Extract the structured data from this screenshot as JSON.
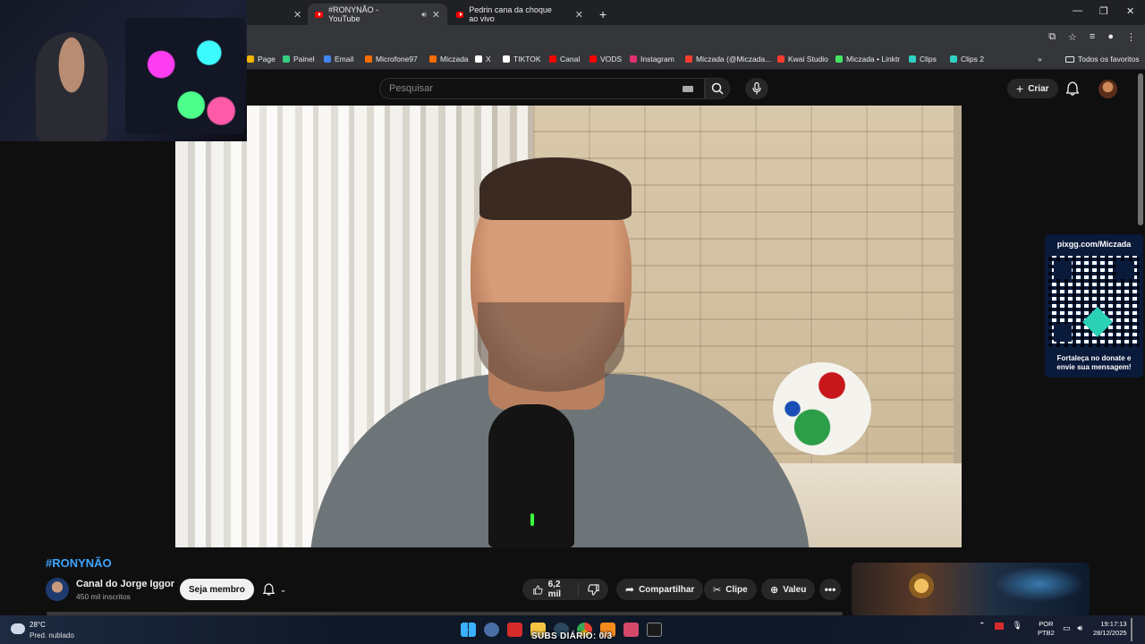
{
  "browser": {
    "tabs": [
      {
        "label": "#RONYNÃO - YouTube",
        "active": true
      },
      {
        "label": "Pedrin cana da choque ao vivo",
        "active": false
      }
    ]
  },
  "bookmarks": [
    {
      "label": "Page",
      "color": "#f4b400"
    },
    {
      "label": "Painel",
      "color": "#35d07f"
    },
    {
      "label": "Email",
      "color": "#4285f4"
    },
    {
      "label": "Microfone97",
      "color": "#ff6d00"
    },
    {
      "label": "Miczada",
      "color": "#ff6d00"
    },
    {
      "label": "X",
      "color": "#ffffff"
    },
    {
      "label": "TIKTOK",
      "color": "#ffffff"
    },
    {
      "label": "Canal",
      "color": "#ff0000"
    },
    {
      "label": "VODS",
      "color": "#ff0000"
    },
    {
      "label": "Instagram",
      "color": "#e1306c"
    },
    {
      "label": "Miczada (@Miczada...",
      "color": "#ff3b30"
    },
    {
      "label": "Kwai Studio",
      "color": "#ff3b30"
    },
    {
      "label": "Miczada • Linktr",
      "color": "#43e660"
    },
    {
      "label": "Clips",
      "color": "#2fd1c5"
    },
    {
      "label": "Clips 2",
      "color": "#2fd1c5"
    }
  ],
  "bookmarks_folder": "Todos os favoritos",
  "youtube_header": {
    "search_placeholder": "Pesquisar",
    "create_label": "Criar"
  },
  "donation": {
    "url": "pixgg.com/Miczada",
    "message_line1": "Fortaleça no donate e",
    "message_line2": "envie sua mensagem!"
  },
  "video": {
    "title": "#RONYNÃO",
    "channel_name": "Canal do Jorge Iggor",
    "subscribers": "450 mil inscritos",
    "member_button": "Seja membro",
    "likes": "6,2 mil",
    "share_label": "Compartilhar",
    "clip_label": "Clipe",
    "thanks_label": "Valeu"
  },
  "taskbar": {
    "temperature": "28°C",
    "weather": "Pred. nublado",
    "overlay_text": "SUBS DIÁRIO: 0/3",
    "lang_1": "POR",
    "lang_2": "PTB2",
    "time": "19:17:13",
    "date": "28/12/2025"
  },
  "colors": {
    "accent_link": "#3ea6ff",
    "yt_red": "#ff0000",
    "background": "#0f0f0f"
  }
}
